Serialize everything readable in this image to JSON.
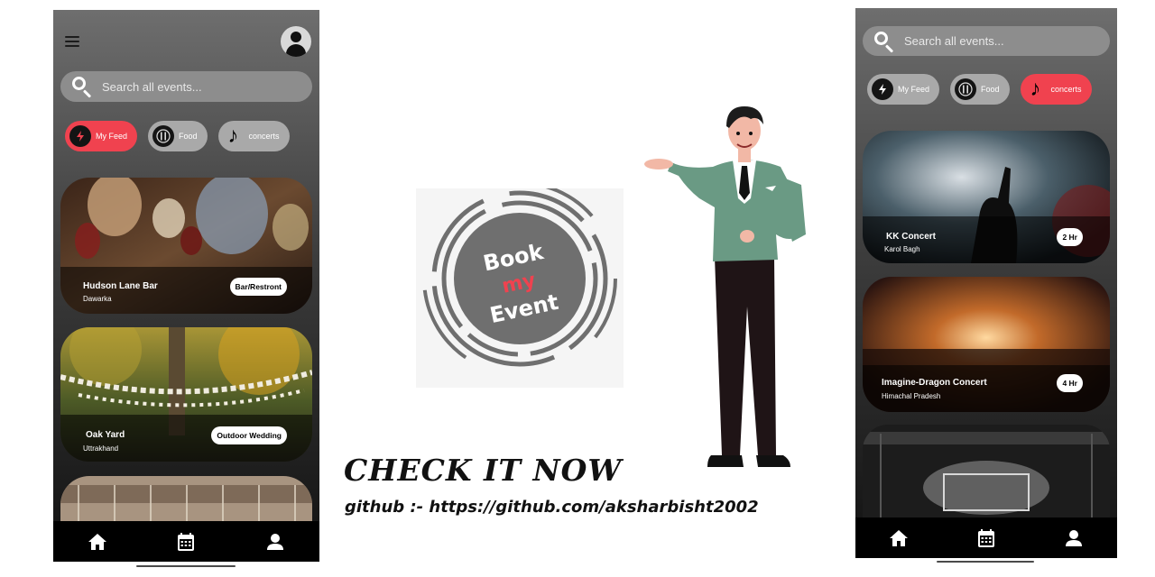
{
  "left_app": {
    "search": {
      "placeholder": "Search all events..."
    },
    "chips": [
      {
        "label": "My Feed",
        "icon": "lightning-icon",
        "active": true
      },
      {
        "label": "Food",
        "icon": "cutlery-icon",
        "active": false
      },
      {
        "label": "concerts",
        "icon": "music-note-icon",
        "active": false
      }
    ],
    "cards": [
      {
        "title": "Hudson Lane Bar",
        "location": "Dawarka",
        "tag": "Bar/Restront"
      },
      {
        "title": "Oak Yard",
        "location": "Uttrakhand",
        "tag": "Outdoor Wedding"
      }
    ],
    "nav": [
      "home-icon",
      "calendar-icon",
      "profile-icon"
    ]
  },
  "right_app": {
    "search": {
      "placeholder": "Search all events..."
    },
    "chips": [
      {
        "label": "My Feed",
        "icon": "lightning-icon",
        "active": false
      },
      {
        "label": "Food",
        "icon": "cutlery-icon",
        "active": false
      },
      {
        "label": "concerts",
        "icon": "music-note-icon",
        "active": true
      }
    ],
    "cards": [
      {
        "title": "KK Concert",
        "location": "Karol Bagh",
        "tag": "2 Hr"
      },
      {
        "title": "Imagine-Dragon Concert",
        "location": "Himachal Pradesh",
        "tag": "4 Hr"
      }
    ],
    "nav": [
      "home-icon",
      "calendar-icon",
      "profile-icon"
    ]
  },
  "logo": {
    "line1": "Book",
    "line2": "my",
    "line3": "Event"
  },
  "promo": {
    "headline": "CHECK IT NOW",
    "github": "github :-  https://github.com/aksharbisht2002"
  },
  "colors": {
    "accent": "#f0424f",
    "chip": "#a9a9a9",
    "search": "#8d8d8d"
  }
}
